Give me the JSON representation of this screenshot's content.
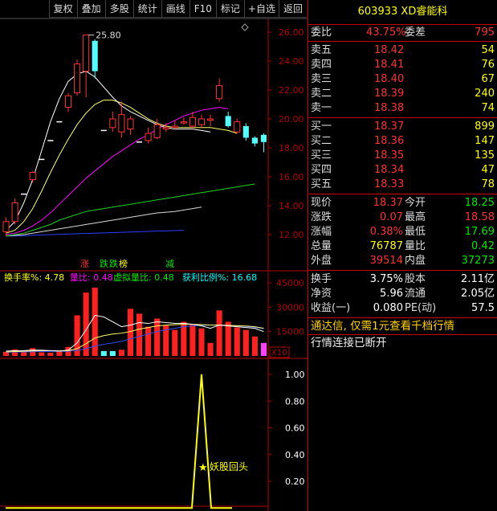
{
  "toolbar": {
    "items": [
      "复权",
      "叠加",
      "多股",
      "统计",
      "画线",
      "F10",
      "标记",
      "+自选",
      "返回"
    ]
  },
  "price_chart": {
    "y_ticks": [
      "26.00",
      "24.00",
      "22.00",
      "20.00",
      "18.00",
      "16.00",
      "14.00",
      "12.00"
    ],
    "y_tick_values": [
      26,
      24,
      22,
      20,
      18,
      16,
      14,
      12
    ],
    "high_label": "25.80",
    "candles": [
      {
        "o": 12.2,
        "c": 12.9,
        "h": 13.2,
        "l": 11.9
      },
      {
        "o": 12.9,
        "c": 14.2,
        "h": 14.5,
        "l": 12.7
      },
      {
        "o": 14.8,
        "c": 14.8,
        "h": 14.8,
        "l": 14.8
      },
      {
        "o": 15.8,
        "c": 16.3,
        "h": 16.4,
        "l": 15.6
      },
      {
        "o": 17.2,
        "c": 17.2,
        "h": 17.2,
        "l": 17.2
      },
      {
        "o": 18.5,
        "c": 18.5,
        "h": 18.5,
        "l": 18.5
      },
      {
        "o": 19.8,
        "c": 19.8,
        "h": 19.8,
        "l": 19.8
      },
      {
        "o": 20.8,
        "c": 21.6,
        "h": 21.8,
        "l": 20.5
      },
      {
        "o": 21.8,
        "c": 23.8,
        "h": 24.1,
        "l": 21.6
      },
      {
        "o": 23.3,
        "c": 25.8,
        "h": 25.8,
        "l": 21.5
      },
      {
        "o": 25.4,
        "c": 23.3,
        "h": 25.5,
        "l": 22.8
      },
      {
        "o": 19.2,
        "c": 19.2,
        "h": 19.2,
        "l": 19.2
      },
      {
        "o": 19.4,
        "c": 20.0,
        "h": 20.5,
        "l": 19.1
      },
      {
        "o": 19.1,
        "c": 20.3,
        "h": 21.2,
        "l": 18.7
      },
      {
        "o": 19.3,
        "c": 20.0,
        "h": 20.2,
        "l": 18.9
      },
      {
        "o": 18.4,
        "c": 18.4,
        "h": 18.4,
        "l": 18.4
      },
      {
        "o": 18.5,
        "c": 19.0,
        "h": 19.4,
        "l": 18.3
      },
      {
        "o": 18.7,
        "c": 19.6,
        "h": 20.0,
        "l": 18.6
      },
      {
        "o": 19.3,
        "c": 19.4,
        "h": 19.7,
        "l": 19.1
      },
      {
        "o": 19.5,
        "c": 19.5,
        "h": 19.9,
        "l": 19.3
      },
      {
        "o": 19.8,
        "c": 19.8,
        "h": 20.1,
        "l": 19.6
      },
      {
        "o": 19.5,
        "c": 20.1,
        "h": 20.5,
        "l": 19.3
      },
      {
        "o": 19.6,
        "c": 20.0,
        "h": 20.3,
        "l": 19.4
      },
      {
        "o": 20.0,
        "c": 20.0,
        "h": 20.3,
        "l": 19.5
      },
      {
        "o": 21.4,
        "c": 22.3,
        "h": 22.8,
        "l": 21.2
      },
      {
        "o": 20.2,
        "c": 19.5,
        "h": 20.5,
        "l": 19.4
      },
      {
        "o": 19.1,
        "c": 19.8,
        "h": 20.0,
        "l": 19.0
      },
      {
        "o": 19.5,
        "c": 18.7,
        "h": 19.7,
        "l": 18.5
      },
      {
        "o": 18.7,
        "c": 18.3,
        "h": 18.8,
        "l": 18.1
      },
      {
        "o": 18.9,
        "c": 18.4,
        "h": 19.0,
        "l": 17.7
      }
    ],
    "ma_white": [
      12.3,
      12.9,
      14.2,
      15.8,
      17.8,
      19.8,
      21.4,
      22.6,
      23.1,
      23.3,
      22.9,
      22.2,
      21.5,
      20.9,
      20.5,
      20.2,
      19.9,
      19.6,
      19.4,
      19.3,
      19.3,
      19.3,
      19.2,
      19.1
    ],
    "ma_yellow": [
      12.1,
      12.3,
      12.9,
      13.8,
      15.0,
      16.3,
      17.5,
      18.6,
      19.6,
      20.4,
      21.0,
      21.3,
      21.3,
      21.1,
      20.8,
      20.4,
      20.0,
      19.7,
      19.5,
      19.4,
      19.4,
      19.4,
      19.4,
      19.4,
      19.3,
      19.2,
      19.0
    ],
    "ma_magenta": [
      12.0,
      12.1,
      12.3,
      12.6,
      13.0,
      13.5,
      14.1,
      14.7,
      15.3,
      15.9,
      16.4,
      16.9,
      17.4,
      17.8,
      18.2,
      18.6,
      18.9,
      19.3,
      19.6,
      19.9,
      20.2,
      20.4,
      20.6,
      20.7,
      20.8,
      20.7
    ],
    "ma_green": [
      11.9,
      12.0,
      12.1,
      12.3,
      12.5,
      12.7,
      13.0,
      13.2,
      13.4,
      13.6,
      13.7,
      13.8,
      13.9,
      14.0,
      14.1,
      14.2,
      14.3,
      14.4,
      14.5,
      14.6,
      14.7,
      14.8,
      14.9,
      15.0,
      15.1,
      15.2,
      15.3,
      15.4,
      15.5
    ],
    "ma_gray": [
      11.9,
      11.95,
      12.0,
      12.1,
      12.2,
      12.3,
      12.4,
      12.5,
      12.6,
      12.7,
      12.8,
      12.9,
      13.0,
      13.1,
      13.2,
      13.3,
      13.4,
      13.5,
      13.55,
      13.6,
      13.7,
      13.8,
      13.9
    ],
    "ma_blue": [
      11.9,
      11.9,
      11.92,
      11.95,
      11.98,
      12.0,
      12.02,
      12.04,
      12.06,
      12.08,
      12.1,
      12.12,
      12.14,
      12.16,
      12.18,
      12.2,
      12.22,
      12.24,
      12.26,
      12.28,
      12.3
    ],
    "tags": [
      {
        "text": "涨",
        "color": "#ff3232"
      },
      {
        "text": "跌",
        "color": "#00e600"
      },
      {
        "text": "榜",
        "color": "#ffff00"
      },
      {
        "text": "减",
        "color": "#00e600"
      }
    ]
  },
  "volume_chart": {
    "header": [
      {
        "text": "换手率%: 4.78",
        "color": "#ffff00"
      },
      {
        "text": "量比: 0.48",
        "color": "#ff00ff"
      },
      {
        "text": "虚拟量比: 0.48",
        "color": "#00e600"
      },
      {
        "text": "获利比例%: 16.68",
        "color": "#00ffff"
      }
    ],
    "y_ticks": [
      "45000",
      "30000",
      "15000"
    ],
    "y_tick_values": [
      45000,
      30000,
      15000
    ],
    "unit": "X10",
    "bars": [
      {
        "v": 2500,
        "c": "red"
      },
      {
        "v": 4000,
        "c": "red"
      },
      {
        "v": 3200,
        "c": "red"
      },
      {
        "v": 4800,
        "c": "red"
      },
      {
        "v": 2200,
        "c": "red"
      },
      {
        "v": 2000,
        "c": "red"
      },
      {
        "v": 3000,
        "c": "red"
      },
      {
        "v": 5500,
        "c": "red"
      },
      {
        "v": 25000,
        "c": "red"
      },
      {
        "v": 39000,
        "c": "red"
      },
      {
        "v": 42000,
        "c": "red"
      },
      {
        "v": 3000,
        "c": "cyan"
      },
      {
        "v": 3000,
        "c": "cyan"
      },
      {
        "v": 3800,
        "c": "red"
      },
      {
        "v": 29000,
        "c": "red"
      },
      {
        "v": 26000,
        "c": "red"
      },
      {
        "v": 18000,
        "c": "red"
      },
      {
        "v": 23000,
        "c": "red"
      },
      {
        "v": 19000,
        "c": "red"
      },
      {
        "v": 16000,
        "c": "red"
      },
      {
        "v": 21000,
        "c": "red"
      },
      {
        "v": 19500,
        "c": "red"
      },
      {
        "v": 17000,
        "c": "red"
      },
      {
        "v": 8000,
        "c": "red"
      },
      {
        "v": 28000,
        "c": "red"
      },
      {
        "v": 21000,
        "c": "red"
      },
      {
        "v": 17500,
        "c": "red"
      },
      {
        "v": 16000,
        "c": "red"
      },
      {
        "v": 12000,
        "c": "red"
      },
      {
        "v": 8000,
        "c": "magenta"
      }
    ],
    "ma_white": [
      3000,
      3200,
      3300,
      3600,
      3500,
      3300,
      3000,
      3600,
      8000,
      16000,
      25000,
      24000,
      21000,
      18000,
      19000,
      20500,
      20000,
      21000,
      20500,
      20000,
      20000,
      19500,
      18500,
      17000,
      19000,
      18500,
      18000,
      17500,
      17000,
      15000
    ],
    "ma_yellow": [
      2500,
      2700,
      2900,
      3100,
      3200,
      3200,
      3100,
      3200,
      4500,
      7500,
      11000,
      12500,
      13500,
      14000,
      15000,
      16500,
      17500,
      18500,
      19000,
      19200,
      19500,
      19500,
      19300,
      19000,
      19000,
      18800,
      18600,
      18400,
      18000,
      17000
    ],
    "ma_blue": [
      2300,
      2400,
      2500,
      2600,
      2700,
      2800,
      2850,
      2900,
      3400,
      4500,
      6000,
      7200,
      8000,
      9000,
      10500,
      12000,
      13500,
      15000,
      16000,
      17000,
      18000,
      18500,
      18800,
      19000,
      19000,
      18800,
      18600,
      18200,
      17600,
      16800
    ]
  },
  "indicator_chart": {
    "y_ticks": [
      "1.00",
      "0.80",
      "0.60",
      "0.40",
      "0.20"
    ],
    "y_tick_values": [
      1.0,
      0.8,
      0.6,
      0.4,
      0.2
    ],
    "signal": {
      "index": 22,
      "value": 1.0
    },
    "label": "妖股回头"
  },
  "quote": {
    "code": "603933",
    "name": "XD睿能科",
    "weibi": {
      "label": "委比",
      "value": "43.75%",
      "label2": "委差",
      "value2": "795"
    },
    "asks": [
      {
        "label": "卖五",
        "price": "18.42",
        "vol": "54"
      },
      {
        "label": "卖四",
        "price": "18.41",
        "vol": "76"
      },
      {
        "label": "卖三",
        "price": "18.40",
        "vol": "67"
      },
      {
        "label": "卖二",
        "price": "18.39",
        "vol": "240"
      },
      {
        "label": "卖一",
        "price": "18.38",
        "vol": "74"
      }
    ],
    "bids": [
      {
        "label": "买一",
        "price": "18.37",
        "vol": "899"
      },
      {
        "label": "买二",
        "price": "18.36",
        "vol": "147"
      },
      {
        "label": "买三",
        "price": "18.35",
        "vol": "135"
      },
      {
        "label": "买四",
        "price": "18.34",
        "vol": "47"
      },
      {
        "label": "买五",
        "price": "18.33",
        "vol": "78"
      }
    ],
    "stats": [
      {
        "l1": "现价",
        "v1": "18.37",
        "c1": "red",
        "l2": "今开",
        "v2": "18.25",
        "c2": "grn"
      },
      {
        "l1": "涨跌",
        "v1": "0.07",
        "c1": "red",
        "l2": "最高",
        "v2": "18.58",
        "c2": "red"
      },
      {
        "l1": "涨幅",
        "v1": "0.38%",
        "c1": "red",
        "l2": "最低",
        "v2": "17.69",
        "c2": "grn"
      },
      {
        "l1": "总量",
        "v1": "76787",
        "c1": "yel",
        "l2": "量比",
        "v2": "0.42",
        "c2": "grn"
      },
      {
        "l1": "外盘",
        "v1": "39514",
        "c1": "red",
        "l2": "内盘",
        "v2": "37273",
        "c2": "grn"
      }
    ],
    "fundamentals": [
      {
        "l1": "换手",
        "v1": "3.75%",
        "l2": "股本",
        "v2": "2.11亿"
      },
      {
        "l1": "净资",
        "v1": "5.96",
        "l2": "流通",
        "v2": "2.05亿"
      },
      {
        "l1": "收益(一)",
        "v1": "0.080",
        "l2": "PE(动)",
        "v2": "57.5"
      }
    ],
    "notice": "通达信, 仅需1元查看千档行情",
    "status": "行情连接已断开"
  },
  "colors": {
    "up": "#ff3232",
    "down": "#00e600",
    "border": "#c00000",
    "axis": "#b40000"
  }
}
